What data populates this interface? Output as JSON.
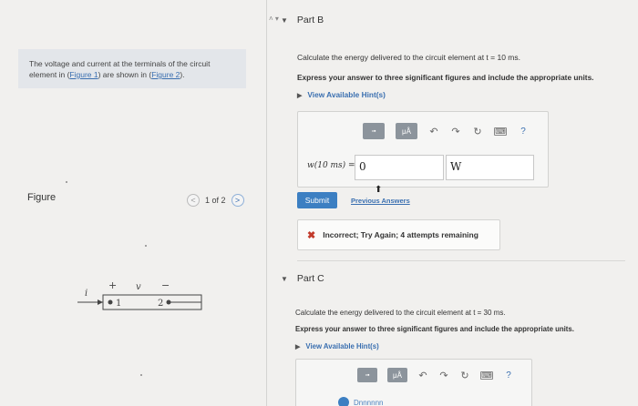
{
  "left": {
    "intro_line1": "The voltage and current at the terminals of the circuit",
    "intro_line2_prefix": "element in (",
    "figure1_link": "Figure 1",
    "intro_mid": ") are shown in (",
    "figure2_link": "Figure 2",
    "intro_end": ").",
    "figure_label": "Figure",
    "figure_pager": "1 of 2",
    "prev_glyph": "<",
    "next_glyph": ">"
  },
  "circuit": {
    "current_symbol": "i",
    "plus": "+",
    "voltage_symbol": "v",
    "minus": "−",
    "terminal1": "1",
    "terminal2": "2"
  },
  "partB": {
    "title": "Part B",
    "question": "Calculate the energy delivered to the circuit element at t = 10 ms.",
    "instructions": "Express your answer to three significant figures and include the appropriate units.",
    "hint_link": "View Available Hint(s)",
    "toolbar": {
      "templates_label": "▫▪",
      "units_label": "μÅ",
      "help_label": "?"
    },
    "answer_label": "w(10 ms) =",
    "answer_value": "0",
    "unit_value": "W",
    "submit_label": "Submit",
    "previous_answers": "Previous Answers",
    "feedback": "Incorrect; Try Again; 4 attempts remaining"
  },
  "partC": {
    "title": "Part C",
    "question": "Calculate the energy delivered to the circuit element at t = 30 ms.",
    "instructions": "Express your answer to three significant figures and include the appropriate units.",
    "hint_link": "View Available Hint(s)",
    "toolbar": {
      "templates_label": "▫▪",
      "units_label": "μÅ",
      "help_label": "?"
    },
    "template_peek": "Dnnnnnn"
  },
  "colors": {
    "link": "#3a6fb0",
    "submit": "#3c7fc2",
    "error": "#c23a2b"
  }
}
